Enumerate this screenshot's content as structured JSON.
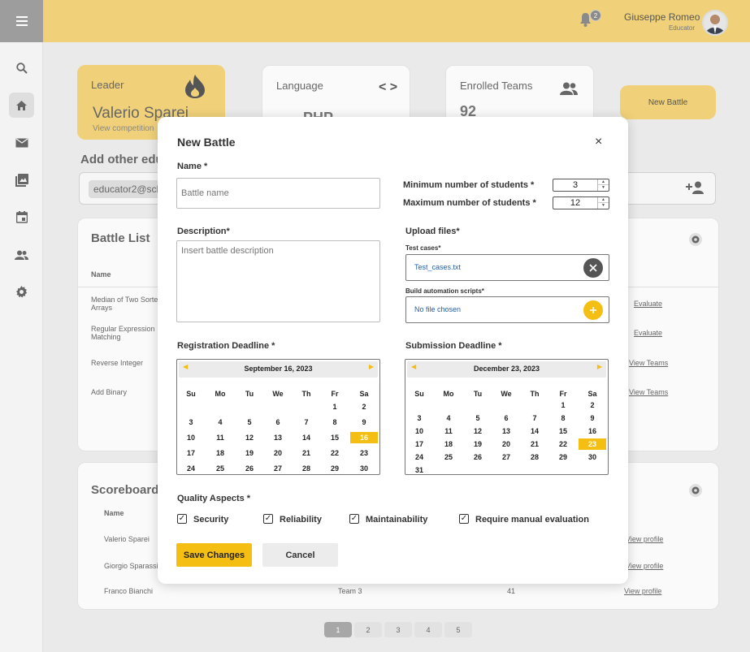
{
  "topbar": {
    "notifications_count": "2",
    "user_name": "Giuseppe Romeo",
    "user_role": "Educator"
  },
  "cards": {
    "leader": {
      "title": "Leader",
      "name": "Valerio Sparei",
      "link": "View competition"
    },
    "language": {
      "title": "Language",
      "value": "PHP"
    },
    "teams": {
      "title": "Enrolled Teams",
      "value": "92"
    },
    "new_battle_label": "New Battle"
  },
  "add_educators": {
    "title": "Add other edu",
    "chip": "educator2@sch"
  },
  "battle_list": {
    "title": "Battle List",
    "header_name": "Name",
    "rows": [
      {
        "name": "Median of Two Sorte\nArrays",
        "action": "Evaluate"
      },
      {
        "name": "Regular Expression\nMatching",
        "action": "Evaluate"
      },
      {
        "name": "Reverse Integer",
        "action": "View Teams"
      },
      {
        "name": "Add Binary",
        "action": "View Teams"
      }
    ]
  },
  "scoreboard": {
    "title": "Scoreboard",
    "header_name": "Name",
    "rows": [
      {
        "name": "Valerio Sparei",
        "action": "View profile"
      },
      {
        "name": "Giorgio Sparassi",
        "action": "View profile"
      },
      {
        "name": "Franco Bianchi",
        "team": "Team 3",
        "score": "41",
        "action": "View profile"
      }
    ]
  },
  "pagination": [
    "1",
    "2",
    "3",
    "4",
    "5"
  ],
  "modal": {
    "title": "New Battle",
    "close_icon": "×",
    "name_label": "Name *",
    "name_placeholder": "Battle name",
    "min_students_label": "Minimum number of students *",
    "min_students_value": "3",
    "max_students_label": "Maximum number of students *",
    "max_students_value": "12",
    "description_label": "Description*",
    "description_placeholder": "Insert battle description",
    "upload_label": "Upload files*",
    "test_cases_label": "Test cases*",
    "test_cases_file": "Test_cases.txt",
    "build_scripts_label": "Build automation scripts*",
    "build_scripts_file": "No file chosen",
    "registration_label": "Registration Deadline *",
    "submission_label": "Submission Deadline *",
    "calendars": {
      "weekdays": [
        "Su",
        "Mo",
        "Tu",
        "We",
        "Th",
        "Fr",
        "Sa"
      ],
      "registration": {
        "month": "September 16, 2023",
        "selected": 16,
        "first_weekday": 5,
        "days": 30
      },
      "submission": {
        "month": "December 23, 2023",
        "selected": 23,
        "first_weekday": 5,
        "days": 31
      }
    },
    "quality_label": "Quality Aspects *",
    "quality_options": [
      "Security",
      "Reliability",
      "Maintainability",
      "Require manual evaluation"
    ],
    "save_label": "Save Changes",
    "cancel_label": "Cancel"
  }
}
